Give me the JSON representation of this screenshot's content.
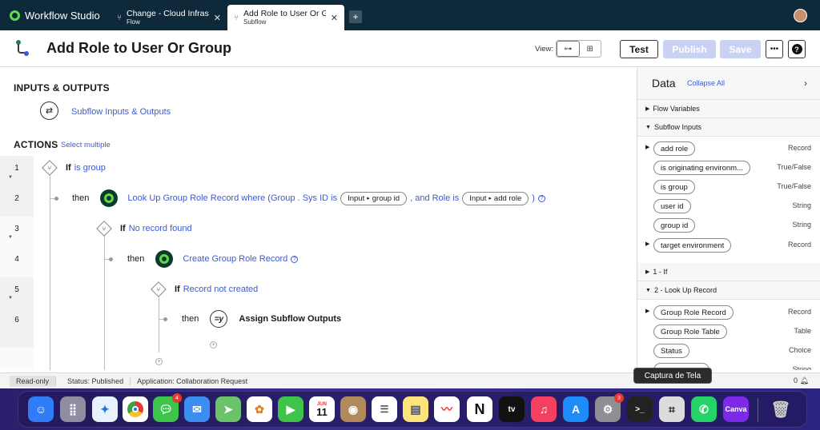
{
  "app": {
    "name": "Workflow Studio"
  },
  "tabs": [
    {
      "title": "Change - Cloud Infrastru",
      "subtitle": "Flow",
      "active": false
    },
    {
      "title": "Add Role to User Or Gro",
      "subtitle": "Subflow",
      "active": true
    }
  ],
  "header": {
    "title": "Add Role to User Or Group",
    "view_label": "View:",
    "test_label": "Test",
    "publish_label": "Publish",
    "save_label": "Save",
    "more_label": "•••",
    "help_label": "?"
  },
  "inputs_outputs": {
    "title": "INPUTS & OUTPUTS",
    "link": "Subflow Inputs & Outputs"
  },
  "actions": {
    "title": "ACTIONS",
    "select_multiple": "Select multiple",
    "rows": [
      {
        "num": "1"
      },
      {
        "num": "2"
      },
      {
        "num": "3"
      },
      {
        "num": "4"
      },
      {
        "num": "5"
      },
      {
        "num": "6"
      }
    ],
    "step1": {
      "if": "If",
      "cond": "is group"
    },
    "step2": {
      "then": "then",
      "text": "Look Up Group Role Record where (Group . Sys ID is",
      "pill1_a": "Input",
      "pill1_b": "group id",
      "mid": ", and Role is",
      "pill2_a": "Input",
      "pill2_b": "add role",
      "end": ")"
    },
    "step3": {
      "if": "If",
      "cond": "No record found"
    },
    "step4": {
      "then": "then",
      "text": "Create Group Role Record"
    },
    "step5": {
      "if": "If",
      "cond": "Record not created"
    },
    "step6": {
      "then": "then",
      "text": "Assign Subflow Outputs"
    }
  },
  "data_panel": {
    "title": "Data",
    "collapse_all": "Collapse All",
    "sections": {
      "flow_vars": "Flow Variables",
      "subflow_inputs": "Subflow Inputs",
      "if1": "1 - If",
      "lookup2": "2 - Look Up Record"
    },
    "inputs": [
      {
        "name": "add role",
        "type": "Record"
      },
      {
        "name": "is originating environm...",
        "type": "True/False"
      },
      {
        "name": "is group",
        "type": "True/False"
      },
      {
        "name": "user id",
        "type": "String"
      },
      {
        "name": "group id",
        "type": "String"
      },
      {
        "name": "target environment",
        "type": "Record"
      }
    ],
    "lookup": [
      {
        "name": "Group Role Record",
        "type": "Record"
      },
      {
        "name": "Group Role Table",
        "type": "Table"
      },
      {
        "name": "Status",
        "type": "Choice"
      },
      {
        "name": "",
        "type": "String"
      }
    ]
  },
  "tooltip": "Captura de Tela",
  "statusbar": {
    "readonly": "Read-only",
    "status": "Status: Published",
    "application": "Application: Collaboration Request",
    "notifications": "0"
  },
  "dock": {
    "calendar_month": "JUN",
    "calendar_day": "11",
    "badges": {
      "messages": "4",
      "settings": "3"
    }
  }
}
